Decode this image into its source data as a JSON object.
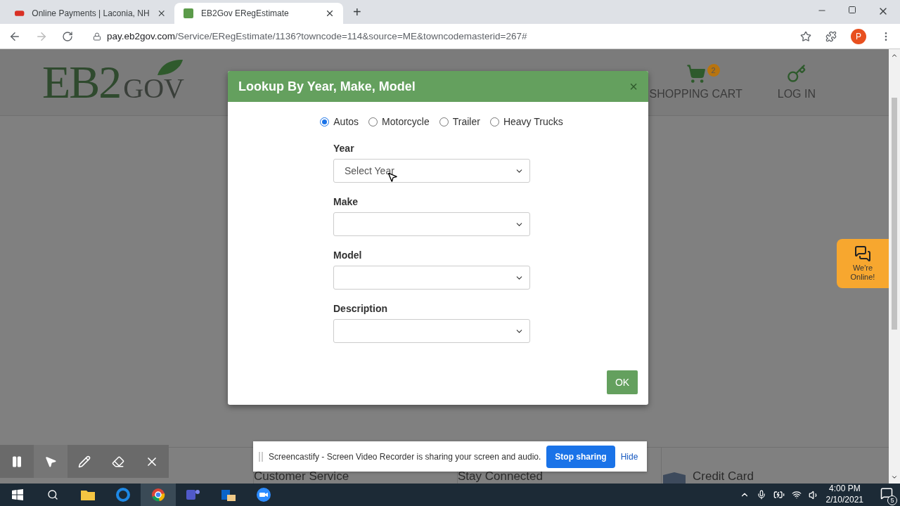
{
  "browser": {
    "tabs": [
      {
        "title": "Online Payments | Laconia, NH",
        "selected": false
      },
      {
        "title": "EB2Gov ERegEstimate",
        "selected": true
      }
    ],
    "new_tab": "+",
    "url_host": "pay.eb2gov.com",
    "url_path": "/Service/ERegEstimate/1136?towncode=114&source=ME&towncodemasterid=267#",
    "profile": "P"
  },
  "header": {
    "logo_main": "EB2",
    "logo_sub": "GOV",
    "cart_label": "SHOPPING CART",
    "cart_count": "2",
    "login": "LOG IN"
  },
  "modal": {
    "title": "Lookup By Year, Make, Model",
    "close": "×",
    "vehicle_types": [
      {
        "label": "Autos",
        "selected": true
      },
      {
        "label": "Motorcycle",
        "selected": false
      },
      {
        "label": "Trailer",
        "selected": false
      },
      {
        "label": "Heavy Trucks",
        "selected": false
      }
    ],
    "fields": [
      {
        "label": "Year",
        "value": "Select Year"
      },
      {
        "label": "Make"
      },
      {
        "label": "Model"
      },
      {
        "label": "Description"
      }
    ],
    "ok": "OK"
  },
  "chat": {
    "label": "We're Online!"
  },
  "footer": [
    "Customer Service",
    "Stay Connected",
    "Credit Card"
  ],
  "sharing_bar": {
    "message": "Screencastify - Screen Video Recorder is sharing your screen and audio.",
    "stop": "Stop sharing",
    "hide": "Hide"
  },
  "taskbar": {
    "time": "4:00 PM",
    "date": "2/10/2021",
    "notifications": "5"
  }
}
